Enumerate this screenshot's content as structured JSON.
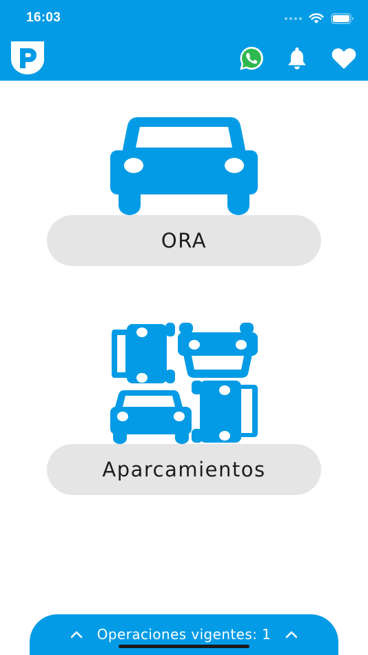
{
  "status_bar": {
    "time": "16:03",
    "icons": [
      "signal-dots-icon",
      "wifi-icon",
      "battery-icon"
    ]
  },
  "app_bar": {
    "logo_letter": "P",
    "actions": [
      "whatsapp-icon",
      "bell-icon",
      "heart-icon"
    ]
  },
  "menu": {
    "ora_label": "ORA",
    "aparcamientos_label": "Aparcamientos"
  },
  "bottom_sheet": {
    "label": "Operaciones vigentes: 1"
  },
  "colors": {
    "primary": "#039be5",
    "pill": "#e5e5e5",
    "text": "#1c1c1c"
  }
}
